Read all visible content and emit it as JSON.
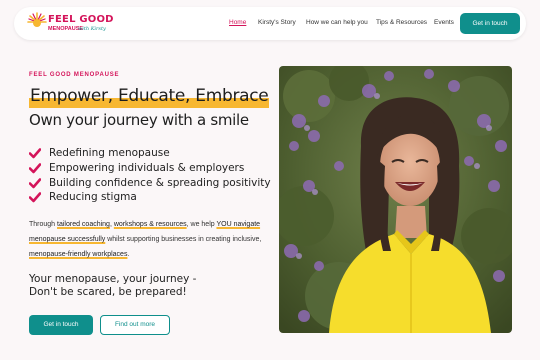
{
  "brand": {
    "line1": "FEEL GOOD",
    "line2": "MENOPAUSE",
    "line3": "with Kirsty",
    "colors": {
      "pink": "#d4145a",
      "teal": "#0f8f8c",
      "yellow": "#f7b731"
    }
  },
  "nav": {
    "items": [
      {
        "label": "Home",
        "active": true
      },
      {
        "label": "Kirsty's Story"
      },
      {
        "label": "How we can help you"
      },
      {
        "label": "Tips & Resources"
      },
      {
        "label": "Events"
      }
    ],
    "cta": "Get in touch"
  },
  "hero": {
    "eyebrow": "FEEL GOOD MENOPAUSE",
    "heading": "Empower, Educate, Embrace",
    "subheading": "Own your journey with a smile",
    "bullets": [
      "Redefining menopause",
      "Empowering individuals & employers",
      "Building confidence & spreading positivity",
      "Reducing stigma"
    ],
    "paragraph": {
      "t1": "Through ",
      "l1": "tailored coaching",
      "t2": ", ",
      "l2": "workshops & resources",
      "t3": ", we help ",
      "l3": "YOU navigate menopause successfully",
      "t4": " whilst supporting businesses in creating inclusive, ",
      "l4": "menopause-friendly workplaces",
      "t5": "."
    },
    "tagline_1": "Your menopause, your journey -",
    "tagline_2": "Don't be scared, be prepared!",
    "primary_button": "Get in touch",
    "secondary_button": "Find out more",
    "check_icon": "check-icon",
    "image_icon": "portrait-photo"
  }
}
